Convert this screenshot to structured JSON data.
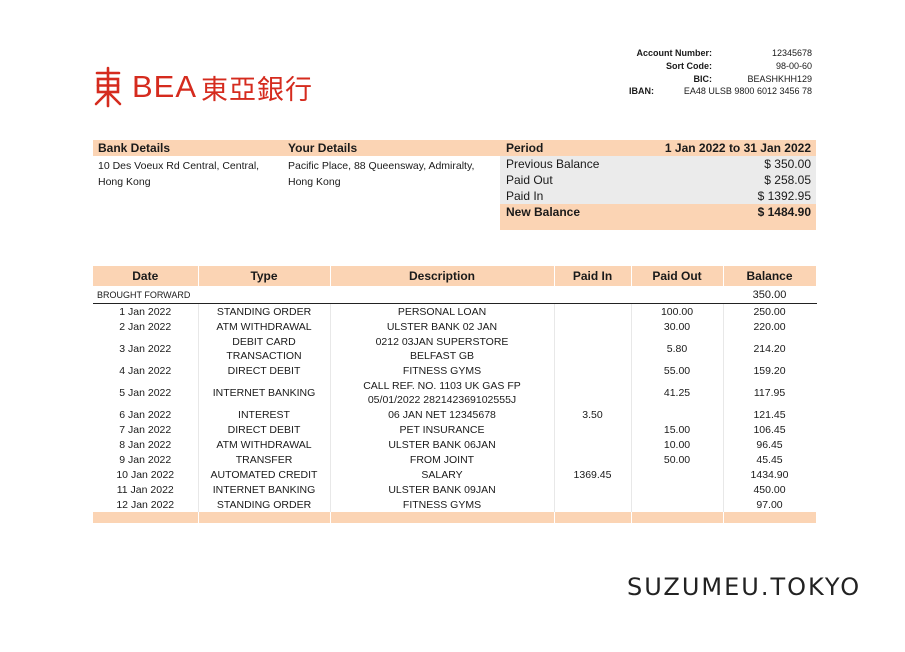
{
  "brand": {
    "latin": "BEA",
    "cjk": "東亞銀行",
    "color": "#d52b1e"
  },
  "account": {
    "labels": [
      "Account Number:",
      "Sort Code:",
      "BIC:"
    ],
    "values": [
      "12345678",
      "98-00-60",
      "BEASHKHH129"
    ],
    "iban_label": "IBAN:",
    "iban_value": "EA48 ULSB 9800 6012 3456 78"
  },
  "bank_details": {
    "heading": "Bank Details",
    "lines": [
      "10 Des Voeux Rd Central, Central,",
      "Hong Kong"
    ]
  },
  "your_details": {
    "heading": "Your Details",
    "lines": [
      "Pacific Place, 88 Queensway, Admiralty,",
      "Hong Kong"
    ]
  },
  "period": {
    "label": "Period",
    "range": "1 Jan 2022 to 31 Jan 2022",
    "previous_label": "Previous Balance",
    "previous_value": "$ 350.00",
    "paid_out_label": "Paid Out",
    "paid_out_value": "$ 258.05",
    "paid_in_label": "Paid In",
    "paid_in_value": "$ 1392.95",
    "new_label": "New Balance",
    "new_value": "$ 1484.90"
  },
  "table": {
    "headers": [
      "Date",
      "Type",
      "Description",
      "Paid In",
      "Paid Out",
      "Balance"
    ],
    "brought_forward_label": "BROUGHT FORWARD",
    "brought_forward_balance": "350.00",
    "rows": [
      {
        "date": "1 Jan 2022",
        "type": "STANDING ORDER",
        "description": "PERSONAL LOAN",
        "paid_in": "",
        "paid_out": "100.00",
        "balance": "250.00"
      },
      {
        "date": "2 Jan 2022",
        "type": "ATM WITHDRAWAL",
        "description": "ULSTER BANK 02 JAN",
        "paid_in": "",
        "paid_out": "30.00",
        "balance": "220.00"
      },
      {
        "date": "3 Jan 2022",
        "type": "DEBIT CARD\nTRANSACTION",
        "description": "0212 03JAN SUPERSTORE\nBELFAST GB",
        "paid_in": "",
        "paid_out": "5.80",
        "balance": "214.20"
      },
      {
        "date": "4 Jan 2022",
        "type": "DIRECT DEBIT",
        "description": "FITNESS GYMS",
        "paid_in": "",
        "paid_out": "55.00",
        "balance": "159.20"
      },
      {
        "date": "5 Jan 2022",
        "type": "INTERNET BANKING",
        "description": "CALL REF. NO. 1103 UK GAS FP\n05/01/2022 282142369102555J",
        "paid_in": "",
        "paid_out": "41.25",
        "balance": "117.95"
      },
      {
        "date": "6 Jan 2022",
        "type": "INTEREST",
        "description": "06 JAN NET 12345678",
        "paid_in": "3.50",
        "paid_out": "",
        "balance": "121.45"
      },
      {
        "date": "7 Jan 2022",
        "type": "DIRECT DEBIT",
        "description": "PET INSURANCE",
        "paid_in": "",
        "paid_out": "15.00",
        "balance": "106.45"
      },
      {
        "date": "8 Jan 2022",
        "type": "ATM WITHDRAWAL",
        "description": "ULSTER BANK 06JAN",
        "paid_in": "",
        "paid_out": "10.00",
        "balance": "96.45"
      },
      {
        "date": "9 Jan 2022",
        "type": "TRANSFER",
        "description": "FROM JOINT",
        "paid_in": "",
        "paid_out": "50.00",
        "balance": "45.45"
      },
      {
        "date": "10 Jan 2022",
        "type": "AUTOMATED CREDIT",
        "description": "SALARY",
        "paid_in": "1369.45",
        "paid_out": "",
        "balance": "1434.90"
      },
      {
        "date": "11 Jan 2022",
        "type": "INTERNET BANKING",
        "description": "ULSTER BANK 09JAN",
        "paid_in": "",
        "paid_out": "",
        "balance": "450.00"
      },
      {
        "date": "12 Jan 2022",
        "type": "STANDING ORDER",
        "description": "FITNESS GYMS",
        "paid_in": "",
        "paid_out": "",
        "balance": "97.00"
      }
    ]
  },
  "watermark": "SUZUMEU.TOKYO"
}
